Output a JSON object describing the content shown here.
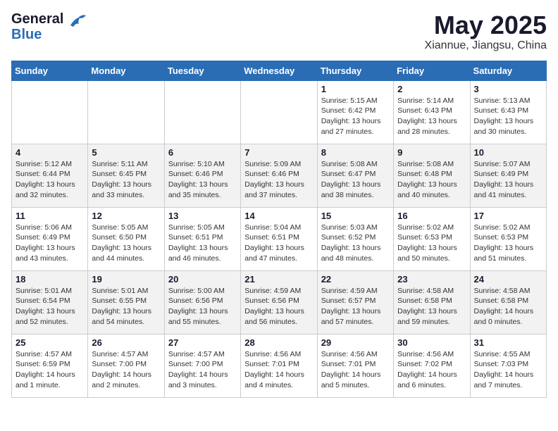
{
  "logo": {
    "general": "General",
    "blue": "Blue"
  },
  "title": "May 2025",
  "location": "Xiannue, Jiangsu, China",
  "weekdays": [
    "Sunday",
    "Monday",
    "Tuesday",
    "Wednesday",
    "Thursday",
    "Friday",
    "Saturday"
  ],
  "weeks": [
    [
      {
        "day": "",
        "content": ""
      },
      {
        "day": "",
        "content": ""
      },
      {
        "day": "",
        "content": ""
      },
      {
        "day": "",
        "content": ""
      },
      {
        "day": "1",
        "content": "Sunrise: 5:15 AM\nSunset: 6:42 PM\nDaylight: 13 hours\nand 27 minutes."
      },
      {
        "day": "2",
        "content": "Sunrise: 5:14 AM\nSunset: 6:43 PM\nDaylight: 13 hours\nand 28 minutes."
      },
      {
        "day": "3",
        "content": "Sunrise: 5:13 AM\nSunset: 6:43 PM\nDaylight: 13 hours\nand 30 minutes."
      }
    ],
    [
      {
        "day": "4",
        "content": "Sunrise: 5:12 AM\nSunset: 6:44 PM\nDaylight: 13 hours\nand 32 minutes."
      },
      {
        "day": "5",
        "content": "Sunrise: 5:11 AM\nSunset: 6:45 PM\nDaylight: 13 hours\nand 33 minutes."
      },
      {
        "day": "6",
        "content": "Sunrise: 5:10 AM\nSunset: 6:46 PM\nDaylight: 13 hours\nand 35 minutes."
      },
      {
        "day": "7",
        "content": "Sunrise: 5:09 AM\nSunset: 6:46 PM\nDaylight: 13 hours\nand 37 minutes."
      },
      {
        "day": "8",
        "content": "Sunrise: 5:08 AM\nSunset: 6:47 PM\nDaylight: 13 hours\nand 38 minutes."
      },
      {
        "day": "9",
        "content": "Sunrise: 5:08 AM\nSunset: 6:48 PM\nDaylight: 13 hours\nand 40 minutes."
      },
      {
        "day": "10",
        "content": "Sunrise: 5:07 AM\nSunset: 6:49 PM\nDaylight: 13 hours\nand 41 minutes."
      }
    ],
    [
      {
        "day": "11",
        "content": "Sunrise: 5:06 AM\nSunset: 6:49 PM\nDaylight: 13 hours\nand 43 minutes."
      },
      {
        "day": "12",
        "content": "Sunrise: 5:05 AM\nSunset: 6:50 PM\nDaylight: 13 hours\nand 44 minutes."
      },
      {
        "day": "13",
        "content": "Sunrise: 5:05 AM\nSunset: 6:51 PM\nDaylight: 13 hours\nand 46 minutes."
      },
      {
        "day": "14",
        "content": "Sunrise: 5:04 AM\nSunset: 6:51 PM\nDaylight: 13 hours\nand 47 minutes."
      },
      {
        "day": "15",
        "content": "Sunrise: 5:03 AM\nSunset: 6:52 PM\nDaylight: 13 hours\nand 48 minutes."
      },
      {
        "day": "16",
        "content": "Sunrise: 5:02 AM\nSunset: 6:53 PM\nDaylight: 13 hours\nand 50 minutes."
      },
      {
        "day": "17",
        "content": "Sunrise: 5:02 AM\nSunset: 6:53 PM\nDaylight: 13 hours\nand 51 minutes."
      }
    ],
    [
      {
        "day": "18",
        "content": "Sunrise: 5:01 AM\nSunset: 6:54 PM\nDaylight: 13 hours\nand 52 minutes."
      },
      {
        "day": "19",
        "content": "Sunrise: 5:01 AM\nSunset: 6:55 PM\nDaylight: 13 hours\nand 54 minutes."
      },
      {
        "day": "20",
        "content": "Sunrise: 5:00 AM\nSunset: 6:56 PM\nDaylight: 13 hours\nand 55 minutes."
      },
      {
        "day": "21",
        "content": "Sunrise: 4:59 AM\nSunset: 6:56 PM\nDaylight: 13 hours\nand 56 minutes."
      },
      {
        "day": "22",
        "content": "Sunrise: 4:59 AM\nSunset: 6:57 PM\nDaylight: 13 hours\nand 57 minutes."
      },
      {
        "day": "23",
        "content": "Sunrise: 4:58 AM\nSunset: 6:58 PM\nDaylight: 13 hours\nand 59 minutes."
      },
      {
        "day": "24",
        "content": "Sunrise: 4:58 AM\nSunset: 6:58 PM\nDaylight: 14 hours\nand 0 minutes."
      }
    ],
    [
      {
        "day": "25",
        "content": "Sunrise: 4:57 AM\nSunset: 6:59 PM\nDaylight: 14 hours\nand 1 minute."
      },
      {
        "day": "26",
        "content": "Sunrise: 4:57 AM\nSunset: 7:00 PM\nDaylight: 14 hours\nand 2 minutes."
      },
      {
        "day": "27",
        "content": "Sunrise: 4:57 AM\nSunset: 7:00 PM\nDaylight: 14 hours\nand 3 minutes."
      },
      {
        "day": "28",
        "content": "Sunrise: 4:56 AM\nSunset: 7:01 PM\nDaylight: 14 hours\nand 4 minutes."
      },
      {
        "day": "29",
        "content": "Sunrise: 4:56 AM\nSunset: 7:01 PM\nDaylight: 14 hours\nand 5 minutes."
      },
      {
        "day": "30",
        "content": "Sunrise: 4:56 AM\nSunset: 7:02 PM\nDaylight: 14 hours\nand 6 minutes."
      },
      {
        "day": "31",
        "content": "Sunrise: 4:55 AM\nSunset: 7:03 PM\nDaylight: 14 hours\nand 7 minutes."
      }
    ]
  ]
}
